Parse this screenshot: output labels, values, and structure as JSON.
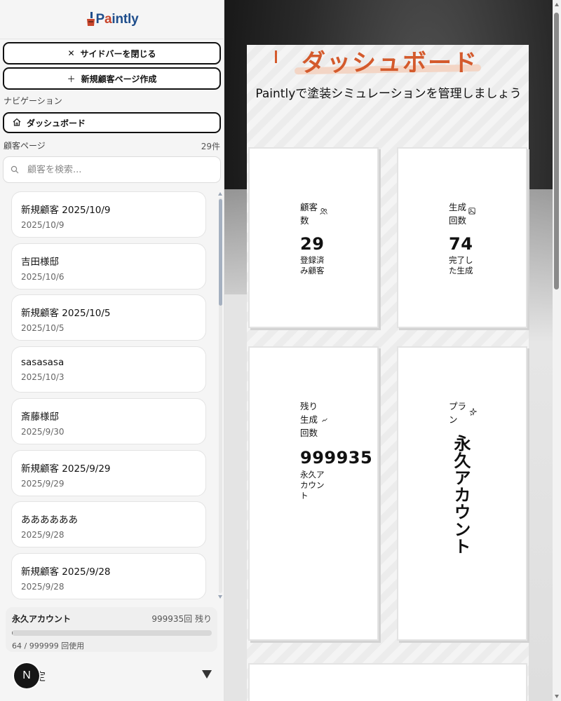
{
  "sidebar": {
    "logo_text": "Paintly",
    "close_label": "サイドバーを閉じる",
    "new_customer_label": "新規顧客ページ作成",
    "nav_heading": "ナビゲーション",
    "nav_dashboard": "ダッシュボード",
    "customer_heading": "顧客ページ",
    "customer_count": "29件",
    "search_placeholder": "顧客を検索...",
    "customers": [
      {
        "name": "新規顧客 2025/10/9",
        "date": "2025/10/9"
      },
      {
        "name": "吉田様邸",
        "date": "2025/10/6"
      },
      {
        "name": "新規顧客 2025/10/5",
        "date": "2025/10/5"
      },
      {
        "name": "sasasasa",
        "date": "2025/10/3"
      },
      {
        "name": "斎藤様邸",
        "date": "2025/9/30"
      },
      {
        "name": "新規顧客 2025/9/29",
        "date": "2025/9/29"
      },
      {
        "name": "ああああああ",
        "date": "2025/9/28"
      },
      {
        "name": "新規顧客 2025/9/28",
        "date": "2025/9/28"
      }
    ],
    "plan": {
      "name": "永久アカウント",
      "remaining": "999935回 残り",
      "usage": "64 / 999999 回使用",
      "used_fraction": 0.0001
    },
    "settings_label": "定",
    "avatar_letter": "N"
  },
  "dashboard": {
    "title": "ダッシュボード",
    "subtitle": "Paintlyで塗装シミュレーションを管理しましょう",
    "stats": {
      "customers": {
        "label": "顧客数",
        "value": "29",
        "sub": "登録済み顧客"
      },
      "generations": {
        "label": "生成回数",
        "value": "74",
        "sub": "完了した生成"
      },
      "remaining": {
        "label": "残り生成回数",
        "value": "999935",
        "sub": "永久アカウント"
      },
      "plan": {
        "label": "プラン",
        "value": "永久アカウント"
      }
    }
  },
  "colors": {
    "accent": "#d45a2c",
    "logo_blue": "#1f4e8c",
    "border": "#111111"
  }
}
